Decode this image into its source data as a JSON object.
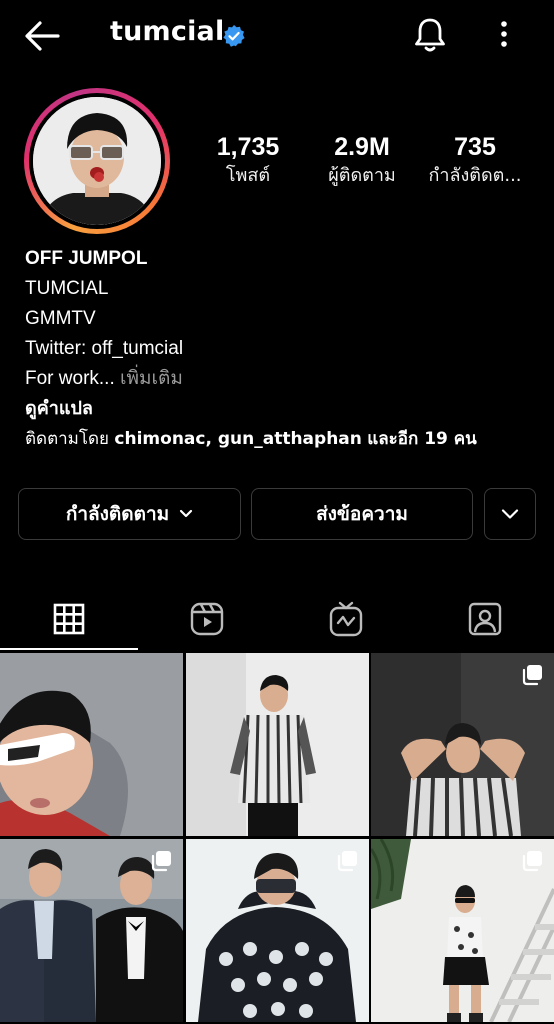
{
  "header": {
    "username": "tumcial",
    "icons": [
      "back-arrow-icon",
      "verified-badge-icon",
      "bell-icon",
      "more-vertical-icon"
    ]
  },
  "profile": {
    "stats": [
      {
        "value": "1,735",
        "label": "โพสต์"
      },
      {
        "value": "2.9M",
        "label": "ผู้ติดตาม"
      },
      {
        "value": "735",
        "label": "กำลังติดต..."
      }
    ],
    "name": "OFF JUMPOL",
    "bio_lines": [
      "TUMCIAL",
      "GMMTV",
      "Twitter: off_tumcial"
    ],
    "bio_truncated": "For work...",
    "see_more": "เพิ่มเติม",
    "translate": "ดูคำแปล",
    "followed_by_prefix": "ติดตามโดย",
    "followed_by_names": "chimonac, gun_atthaphan",
    "followed_by_suffix": "และอีก 19 คน"
  },
  "actions": {
    "following": "กำลังติดตาม",
    "message": "ส่งข้อความ"
  },
  "tabs": [
    {
      "name": "posts-grid",
      "icon": "grid-icon",
      "active": true
    },
    {
      "name": "reels",
      "icon": "reels-icon",
      "active": false
    },
    {
      "name": "igtv",
      "icon": "igtv-icon",
      "active": false
    },
    {
      "name": "tagged",
      "icon": "tagged-person-icon",
      "active": false
    }
  ],
  "posts": [
    {
      "subject": "portrait with white sunglasses",
      "multiple": false
    },
    {
      "subject": "standing in striped shirt",
      "multiple": false
    },
    {
      "subject": "hands behind head in striped shirt",
      "multiple": true
    },
    {
      "subject": "two men in suits",
      "multiple": true
    },
    {
      "subject": "covering eyes in patterned sweater",
      "multiple": true
    },
    {
      "subject": "standing by white staircase",
      "multiple": true
    }
  ],
  "colors": {
    "background": "#000000",
    "verified": "#3897f0",
    "button_border": "#3a3a3a",
    "muted_text": "#9a9a9a"
  }
}
